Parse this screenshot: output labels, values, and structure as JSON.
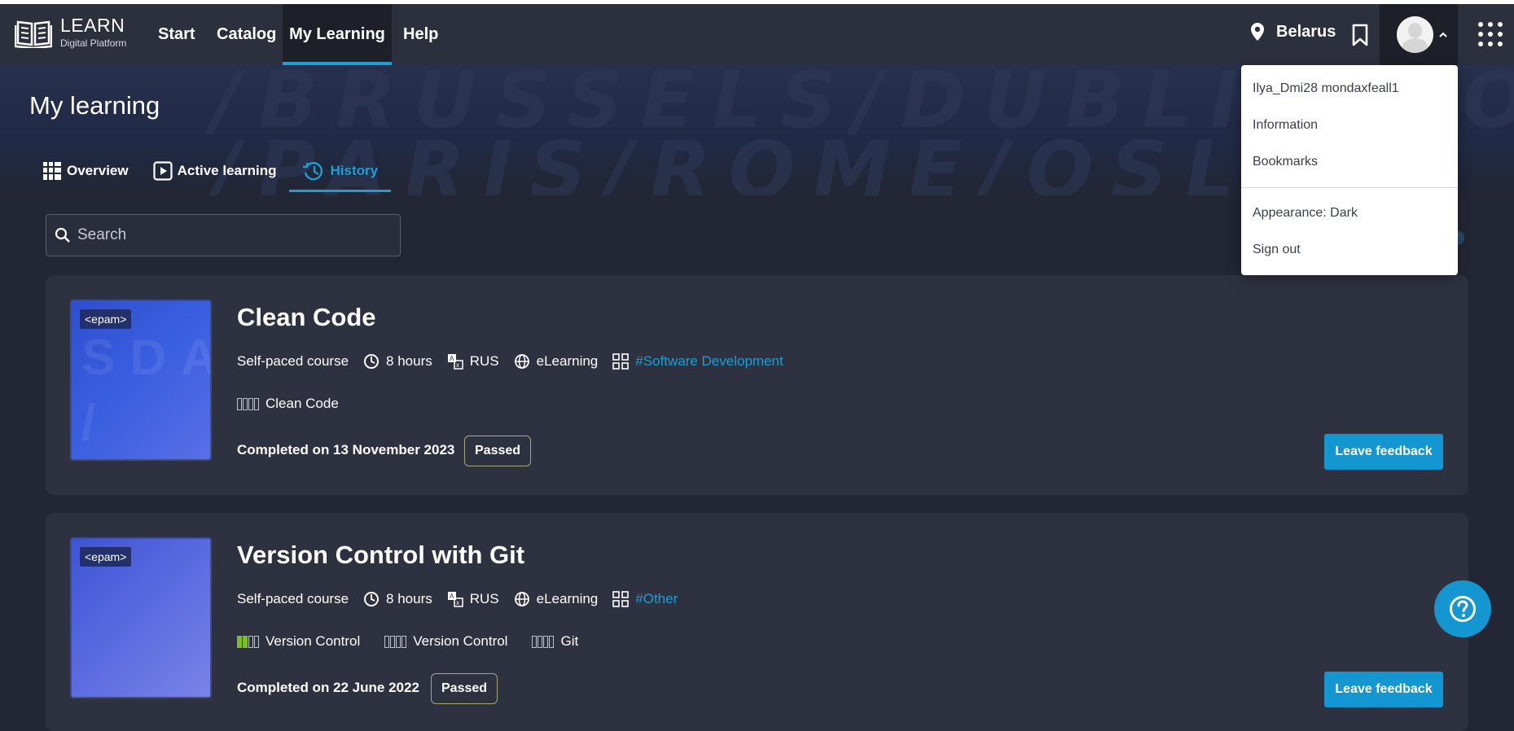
{
  "nav": {
    "logo_title": "LEARN",
    "logo_subtitle": "Digital Platform",
    "items": [
      "Start",
      "Catalog",
      "My Learning",
      "Help"
    ],
    "location": "Belarus"
  },
  "hero": {
    "bg_line1": "/BRUSSELS/DUBLIN/POTS",
    "bg_line2": "/PARIS/ROME/OSLO/"
  },
  "page": {
    "title": "My learning",
    "tabs": [
      "Overview",
      "Active learning",
      "History"
    ]
  },
  "search": {
    "placeholder": "Search"
  },
  "courses": [
    {
      "brand": "<epam>",
      "thumb_text": "SDA / FE",
      "title": "Clean Code",
      "type": "Self-paced course",
      "duration": "8 hours",
      "language": "RUS",
      "format": "eLearning",
      "tag": "#Software Development",
      "skills": [
        {
          "name": "Clean Code",
          "level": 0
        }
      ],
      "completed": "Completed on 13 November 2023",
      "status": "Passed",
      "feedback_label": "Leave feedback"
    },
    {
      "brand": "<epam>",
      "thumb_text": "",
      "title": "Version Control with Git",
      "type": "Self-paced course",
      "duration": "8 hours",
      "language": "RUS",
      "format": "eLearning",
      "tag": "#Other",
      "skills": [
        {
          "name": "Version Control",
          "level": 2
        },
        {
          "name": "Version Control",
          "level": 0
        },
        {
          "name": "Git",
          "level": 0
        }
      ],
      "completed": "Completed on 22 June 2022",
      "status": "Passed",
      "feedback_label": "Leave feedback"
    }
  ],
  "user_menu": {
    "username": "Ilya_Dmi28 mondaxfeall1",
    "information": "Information",
    "bookmarks": "Bookmarks",
    "appearance": "Appearance: Dark",
    "sign_out": "Sign out"
  },
  "colors": {
    "accent": "#1a9fd6",
    "button": "#1497d0",
    "skill_filled": "#7ac01e",
    "background": "#232634",
    "card": "#2e3140"
  },
  "icons": [
    "book-logo-icon",
    "location-pin-icon",
    "bookmark-icon",
    "avatar-icon",
    "chevron-up-icon",
    "apps-grid-icon",
    "overview-grid-icon",
    "play-icon",
    "history-icon",
    "search-icon",
    "clock-icon",
    "language-icon",
    "globe-icon",
    "tag-grid-icon",
    "help-icon"
  ]
}
